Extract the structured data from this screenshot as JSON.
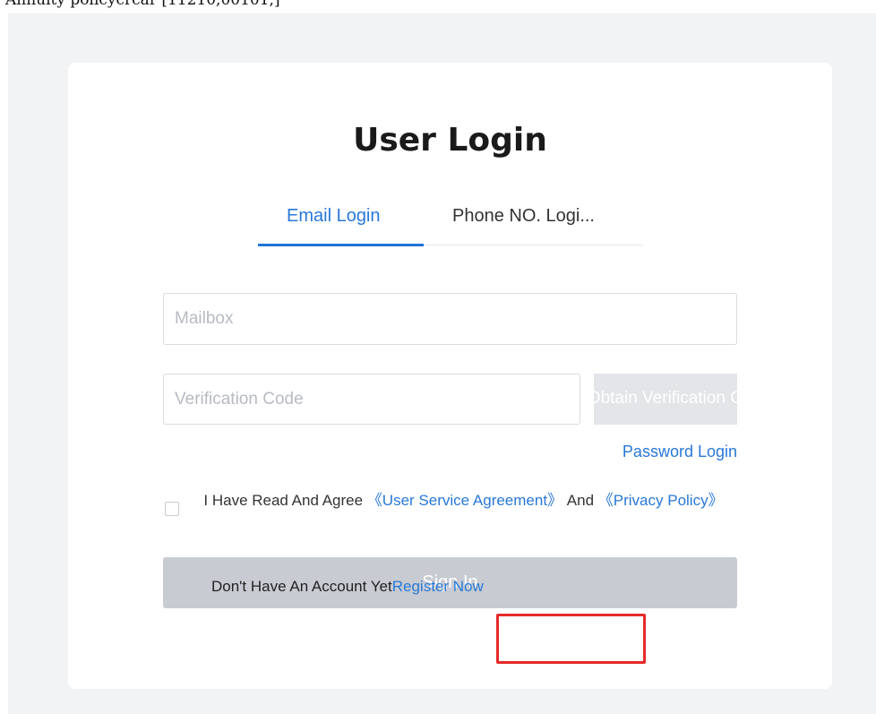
{
  "caption_fragment": "Annuity policycrcar [11210,00101,]",
  "login": {
    "title": "User Login",
    "tabs": [
      {
        "label": "Email Login",
        "active": true
      },
      {
        "label": "Phone NO. Logi...",
        "active": false
      }
    ],
    "mailbox_placeholder": "Mailbox",
    "verification_placeholder": "Verification Code",
    "get_code_label": "Obtain Verification C",
    "password_login": "Password Login",
    "agreement": {
      "prefix": "I Have Read And Agree",
      "service_link": "《User Service Agreement》",
      "joiner": "And",
      "privacy_link": "《Privacy Policy》",
      "checked": false
    },
    "sign_in_label": "Sign In",
    "register_prompt": "Don't Have An Account Yet",
    "register_link": "Register Now"
  },
  "colors": {
    "accent": "#2878d8",
    "highlight": "#e52a2a",
    "disabled_button": "#c8cbd1"
  }
}
